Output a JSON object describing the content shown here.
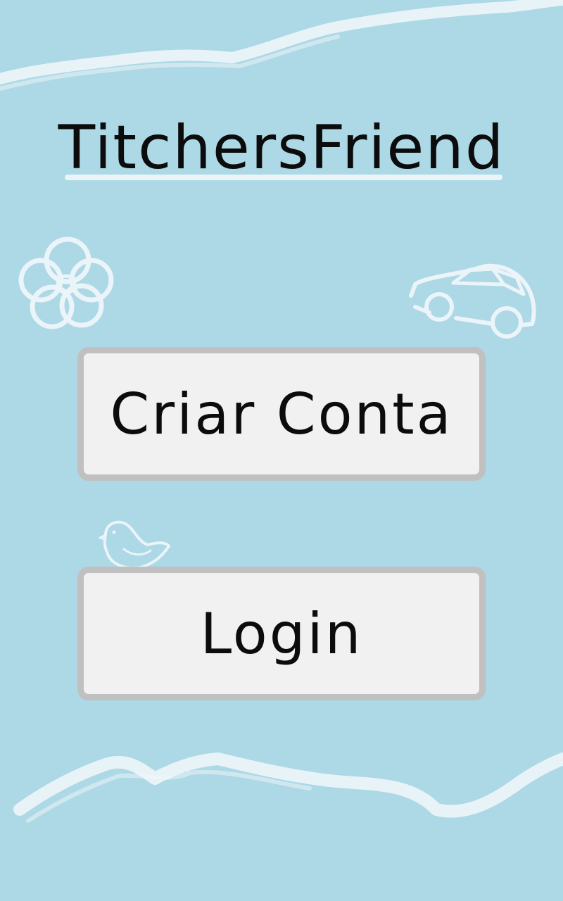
{
  "app": {
    "title": "TitchersFriend"
  },
  "buttons": {
    "create_account_label": "Criar Conta",
    "login_label": "Login"
  },
  "icons": {
    "decorations": [
      "flower-icon",
      "car-icon",
      "bird-icon"
    ]
  },
  "colors": {
    "background": "#add8e6",
    "button_fill": "#f1f1f1",
    "button_border": "#c0c0c0",
    "chalk": "#f2f8fa",
    "text": "#0c0c0c"
  }
}
